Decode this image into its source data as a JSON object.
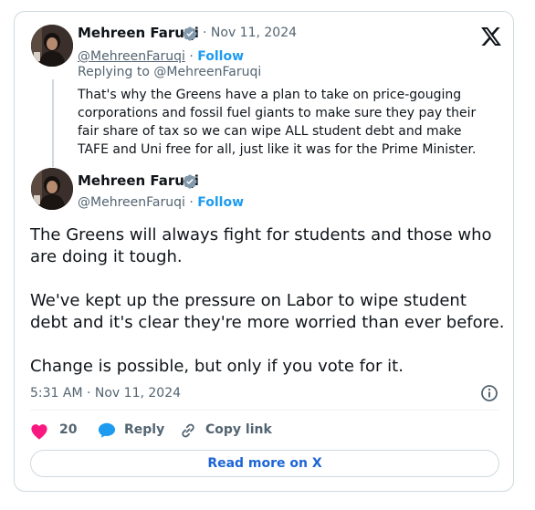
{
  "reply_context": {
    "author_name": "Mehreen Faruqi",
    "date": "· Nov 11, 2024",
    "handle": "@MehreenFaruqi",
    "follow_sep": " · ",
    "follow_label": "Follow",
    "replying_to": "Replying to @MehreenFaruqi",
    "text": "That's why the Greens have a plan to take on price-gouging corporations and fossil fuel giants to make sure they pay their fair share of tax so we can wipe ALL student debt and make TAFE and Uni free for all, just like it was for the Prime Minister."
  },
  "main_post": {
    "author_name": "Mehreen Faruqi",
    "handle": "@MehreenFaruqi",
    "follow_sep": " · ",
    "follow_label": "Follow",
    "paragraph_1": "The Greens will always fight for students and those who are doing it tough.",
    "paragraph_2": "We've kept up the pressure on Labor to wipe student debt and it's clear they're more worried than ever before.",
    "paragraph_3": "Change is possible, but only if you vote for it.",
    "timestamp": "5:31 AM · Nov 11, 2024"
  },
  "actions": {
    "like_count": "20",
    "reply_label": "Reply",
    "copy_label": "Copy link"
  },
  "read_more_label": "Read more on X",
  "icons": {
    "verified": "verified-badge-icon",
    "logo": "x-logo-icon",
    "info": "info-icon",
    "heart": "heart-icon",
    "reply": "reply-bubble-icon",
    "link": "link-icon"
  },
  "colors": {
    "accent": "#1d9bf0",
    "heart": "#f91880",
    "muted": "#536471",
    "text": "#0f1419",
    "border": "#cfd9de"
  }
}
